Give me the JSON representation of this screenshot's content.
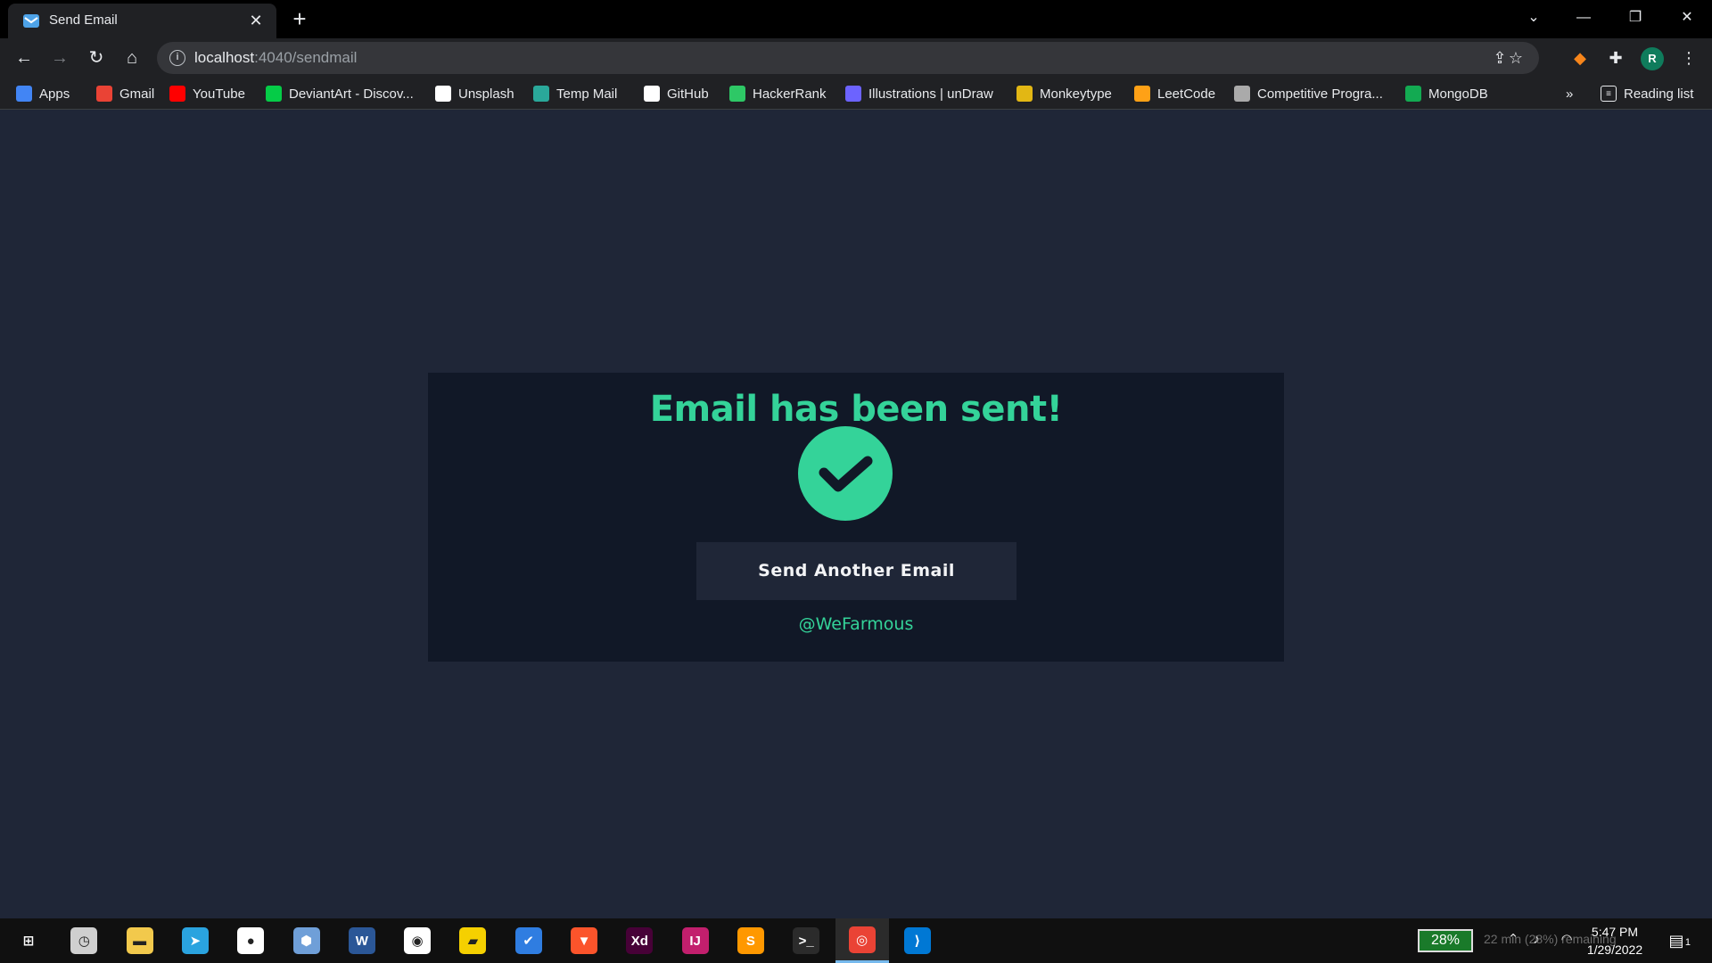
{
  "browser": {
    "tab_title": "Send Email",
    "tab_close": "✕",
    "new_tab": "+",
    "url_host": "localhost",
    "url_path": ":4040/sendmail",
    "avatar_letter": "R",
    "bookmarks_overflow": "»",
    "reading_list": "Reading list",
    "bookmarks": [
      {
        "label": "Apps",
        "icon": "apps-grid-icon",
        "color": "#4285f4"
      },
      {
        "label": "Gmail",
        "icon": "gmail-icon",
        "color": "#ea4335"
      },
      {
        "label": "YouTube",
        "icon": "youtube-icon",
        "color": "#ff0000"
      },
      {
        "label": "DeviantArt - Discov...",
        "icon": "deviantart-icon",
        "color": "#05cc47"
      },
      {
        "label": "Unsplash",
        "icon": "unsplash-icon",
        "color": "#ffffff"
      },
      {
        "label": "Temp Mail",
        "icon": "tempmail-icon",
        "color": "#2aa89a"
      },
      {
        "label": "GitHub",
        "icon": "github-icon",
        "color": "#ffffff"
      },
      {
        "label": "HackerRank",
        "icon": "hackerrank-icon",
        "color": "#2ec866"
      },
      {
        "label": "Illustrations | unDraw",
        "icon": "undraw-icon",
        "color": "#6c63ff"
      },
      {
        "label": "Monkeytype",
        "icon": "monkeytype-icon",
        "color": "#e2b714"
      },
      {
        "label": "LeetCode",
        "icon": "leetcode-icon",
        "color": "#ffa116"
      },
      {
        "label": "Competitive Progra...",
        "icon": "cc-icon",
        "color": "#aaaaaa"
      },
      {
        "label": "MongoDB",
        "icon": "mongodb-icon",
        "color": "#13aa52"
      }
    ]
  },
  "page": {
    "headline": "Email has been sent!",
    "button_label": "Send Another Email",
    "handle": "@WeFarmous",
    "accent_color": "#34d399",
    "card_color": "#111827",
    "background_color": "#1f2637"
  },
  "taskbar": {
    "battery": "28%",
    "battery_tooltip": "22 min (28%) remaining",
    "time": "5:47 PM",
    "date": "1/29/2022",
    "notification_count": "1",
    "apps": [
      {
        "name": "start-button",
        "glyph": "⊞",
        "bg": "transparent"
      },
      {
        "name": "clock-app-icon",
        "glyph": "◷",
        "bg": "#cfcfcf"
      },
      {
        "name": "file-explorer-icon",
        "glyph": "▬",
        "bg": "#f2c94c"
      },
      {
        "name": "telegram-icon",
        "glyph": "➤",
        "bg": "#2aa3df"
      },
      {
        "name": "mongodb-compass-icon",
        "glyph": "●",
        "bg": "#ffffff"
      },
      {
        "name": "virtualbox-icon",
        "glyph": "⬢",
        "bg": "#6f9fd8"
      },
      {
        "name": "word-icon",
        "glyph": "W",
        "bg": "#2b5797"
      },
      {
        "name": "cortana-icon",
        "glyph": "◉",
        "bg": "#ffffff"
      },
      {
        "name": "sticky-notes-icon",
        "glyph": "▰",
        "bg": "#f5d000"
      },
      {
        "name": "todo-icon",
        "glyph": "✔",
        "bg": "#2f7de1"
      },
      {
        "name": "brave-icon",
        "glyph": "▼",
        "bg": "#fb542b"
      },
      {
        "name": "adobe-xd-icon",
        "glyph": "Xd",
        "bg": "#470137"
      },
      {
        "name": "intellij-icon",
        "glyph": "IJ",
        "bg": "#c21f6d"
      },
      {
        "name": "sublime-icon",
        "glyph": "S",
        "bg": "#ff9800"
      },
      {
        "name": "terminal-icon",
        "glyph": ">_",
        "bg": "#2b2b2b"
      },
      {
        "name": "chrome-icon",
        "glyph": "◎",
        "bg": "#ea4335"
      },
      {
        "name": "vscode-icon",
        "glyph": "⟩",
        "bg": "#0078d4"
      }
    ]
  }
}
